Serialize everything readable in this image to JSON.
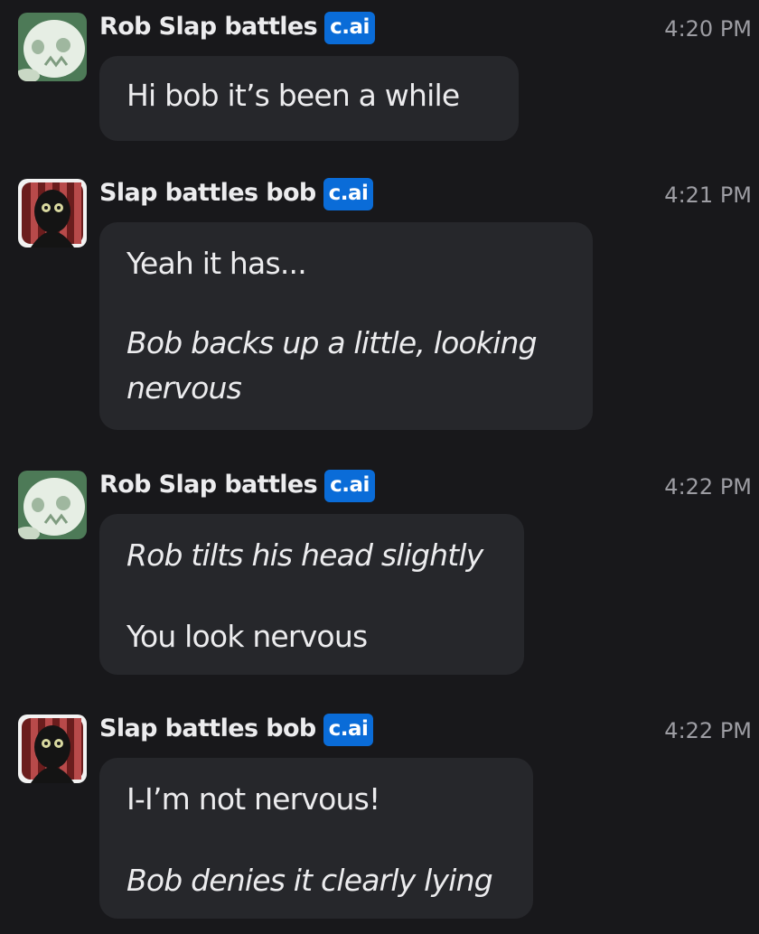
{
  "messages": [
    {
      "author": "Rob Slap battles",
      "badge": "c.ai",
      "time": "4:20 PM",
      "avatar": "white-skull-avatar",
      "lines": [
        "Hi bob it’s been a while"
      ]
    },
    {
      "author": "Slap battles bob",
      "badge": "c.ai",
      "time": "4:21 PM",
      "avatar": "dark-hooded-figure-avatar",
      "lines": [
        "Yeah it has...",
        "Bob backs up a little, looking",
        "nervous"
      ]
    },
    {
      "author": "Rob Slap battles",
      "badge": "c.ai",
      "time": "4:22 PM",
      "avatar": "white-skull-avatar",
      "lines": [
        "Rob tilts his head slightly",
        "You look nervous"
      ]
    },
    {
      "author": "Slap battles bob",
      "badge": "c.ai",
      "time": "4:22 PM",
      "avatar": "dark-hooded-figure-avatar",
      "lines": [
        "I-I’m not nervous!",
        "Bob denies it clearly lying"
      ]
    }
  ]
}
